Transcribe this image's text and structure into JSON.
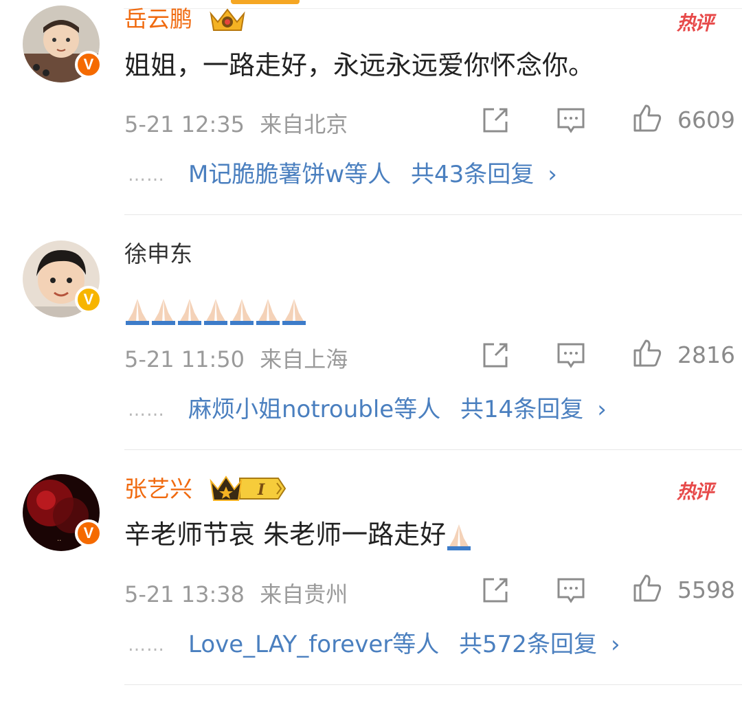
{
  "comments": [
    {
      "username": "岳云鹏",
      "text": "姐姐，一路走好，永远永远爱你怀念你。",
      "time": "5-21 12:35",
      "location": "来自北京",
      "likes": "6609",
      "hot_label": "热评",
      "reply_users": "M记脆脆薯饼w",
      "reply_mid": "等人",
      "reply_count_text": "共43条回复",
      "chevron": "›"
    },
    {
      "username": "徐申东",
      "text": "",
      "time": "5-21 11:50",
      "location": "来自上海",
      "likes": "2816",
      "reply_users": "麻烦小姐notrouble",
      "reply_mid": "等人",
      "reply_count_text": "共14条回复",
      "chevron": "›"
    },
    {
      "username": "张艺兴",
      "vip_level": "I",
      "text": "辛老师节哀 朱老师一路走好",
      "time": "5-21 13:38",
      "location": "来自贵州",
      "likes": "5598",
      "hot_label": "热评",
      "reply_users": "Love_LAY_forever",
      "reply_mid": "等人",
      "reply_count_text": "共572条回复",
      "chevron": "›"
    }
  ],
  "reply_dots": "……",
  "colors": {
    "vip_name": "#f06a0f",
    "link_blue": "#4a7fbf",
    "meta_gray": "#9a9a9a",
    "hot_red": "#e74a4a",
    "badge_yellow": "#f7b500",
    "badge_orange": "#f56a00"
  },
  "icons": [
    "share-icon",
    "comment-icon",
    "like-icon",
    "praying-hands-emoji",
    "verified-v-badge",
    "vip-crown-icon"
  ]
}
